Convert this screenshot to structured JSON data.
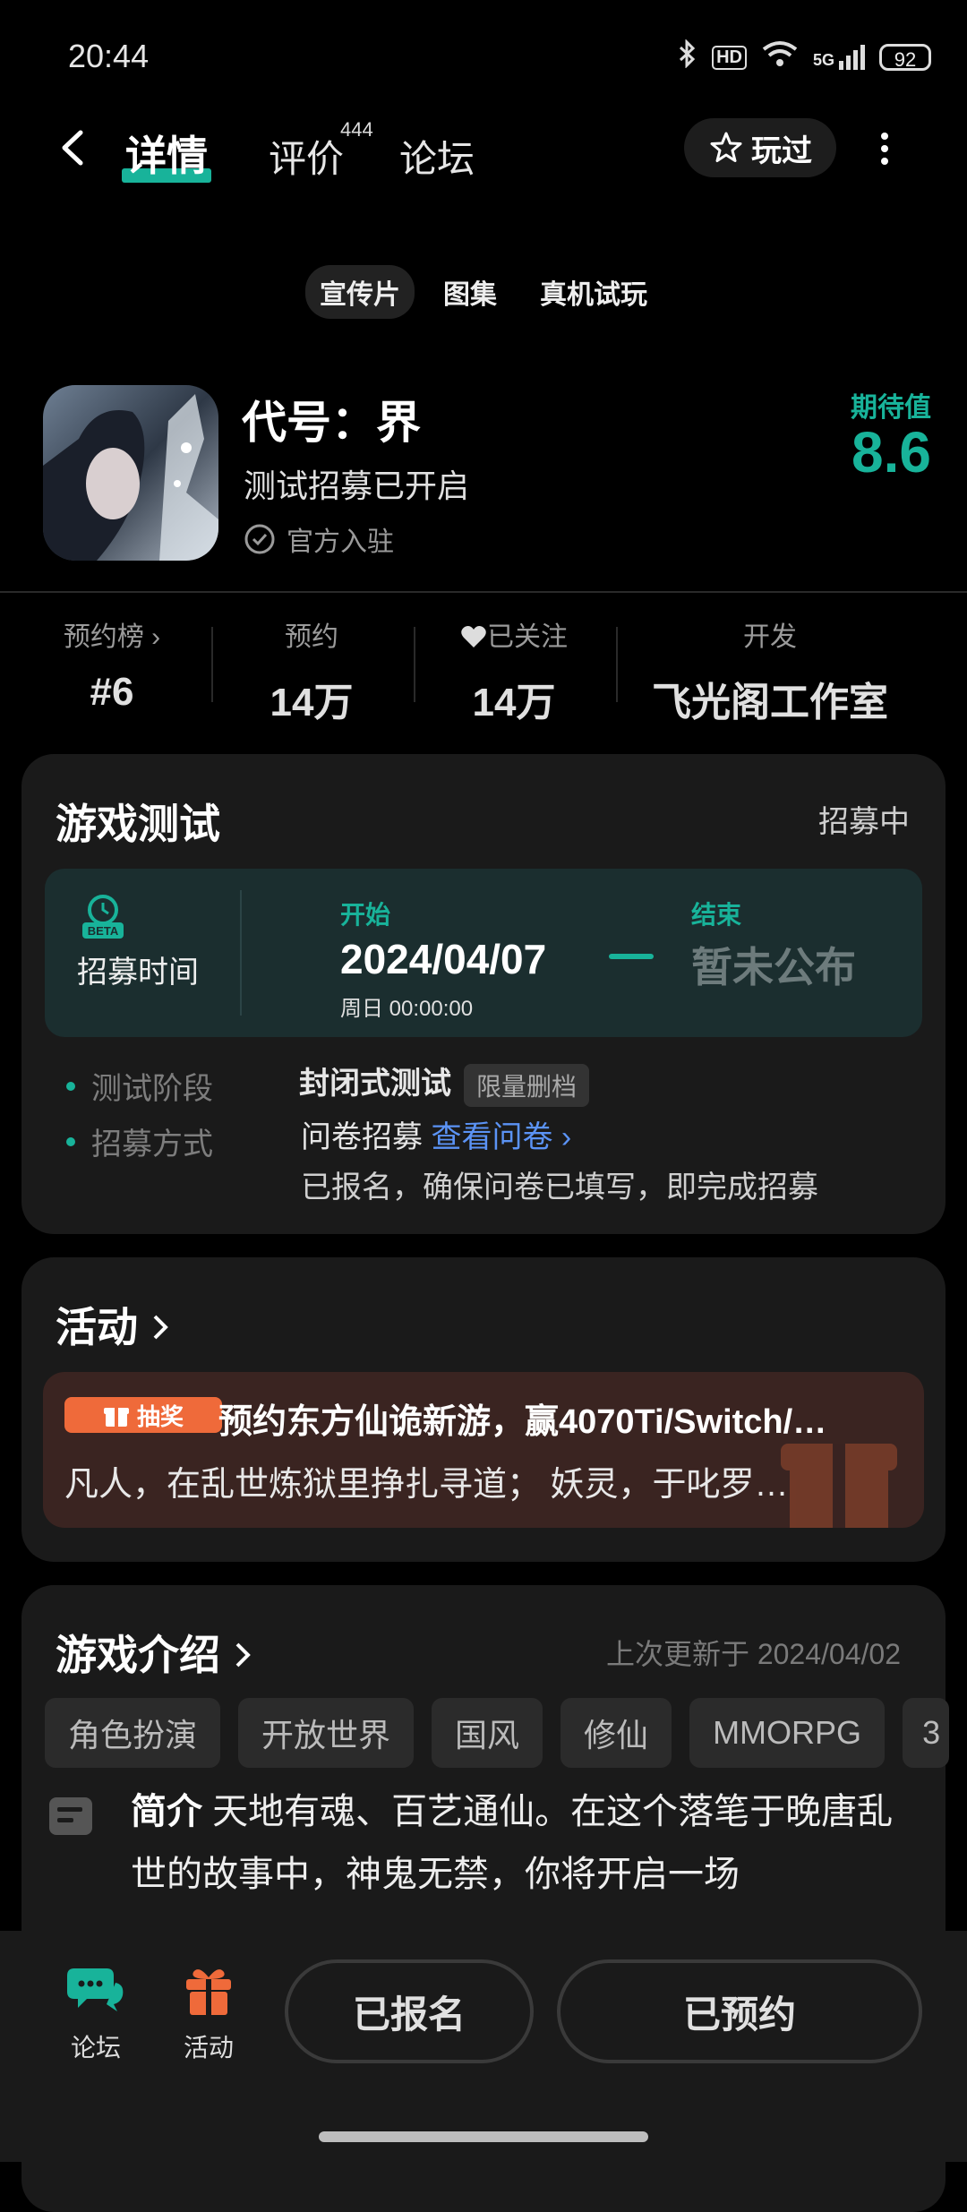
{
  "status": {
    "time": "20:44",
    "battery": "92",
    "network": "5G"
  },
  "nav": {
    "tabs": [
      "详情",
      "评价",
      "论坛"
    ],
    "review_count": "444",
    "played_label": "玩过"
  },
  "media_tabs": [
    "宣传片",
    "图集",
    "真机试玩"
  ],
  "game": {
    "title": "代号：界",
    "subtitle": "测试招募已开启",
    "official": "官方入驻",
    "expect_label": "期待值",
    "expect_value": "8.6"
  },
  "stats": {
    "rank_label": "预约榜",
    "rank_value": "#6",
    "reserve_label": "预约",
    "reserve_value": "14万",
    "follow_label": "已关注",
    "follow_value": "14万",
    "dev_label": "开发",
    "dev_value": "飞光阁工作室"
  },
  "test": {
    "title": "游戏测试",
    "status": "招募中",
    "recruit_label": "招募时间",
    "beta": "BETA",
    "start_label": "开始",
    "start_date": "2024/04/07",
    "start_time": "周日  00:00:00",
    "end_label": "结束",
    "end_value": "暂未公布",
    "stage_label": "测试阶段",
    "stage_value": "封闭式测试",
    "stage_pill": "限量删档",
    "method_label": "招募方式",
    "method_value": "问卷招募",
    "method_link": "查看问卷",
    "method_note": "已报名，确保问卷已填写，即完成招募"
  },
  "activity": {
    "title": "活动",
    "badge": "抽奖",
    "promo_title": "预约东方仙诡新游，赢4070Ti/Switch/…",
    "promo_desc": "凡人，在乱世炼狱里挣扎寻道； 妖灵，于叱罗…"
  },
  "intro": {
    "title": "游戏介绍",
    "updated": "上次更新于 2024/04/02",
    "tags": [
      "角色扮演",
      "开放世界",
      "国风",
      "修仙",
      "MMORPG",
      "3"
    ],
    "label": "简介",
    "text": "天地有魂、百艺通仙。在这个落笔于晚唐乱世的故事中，神鬼无禁，你将开启一场"
  },
  "bottom": {
    "forum": "论坛",
    "activity": "活动",
    "signed_up": "已报名",
    "reserved": "已预约"
  },
  "colors": {
    "accent": "#18b39a",
    "link": "#5b93f5",
    "promo_badge": "#ef6a3a"
  }
}
